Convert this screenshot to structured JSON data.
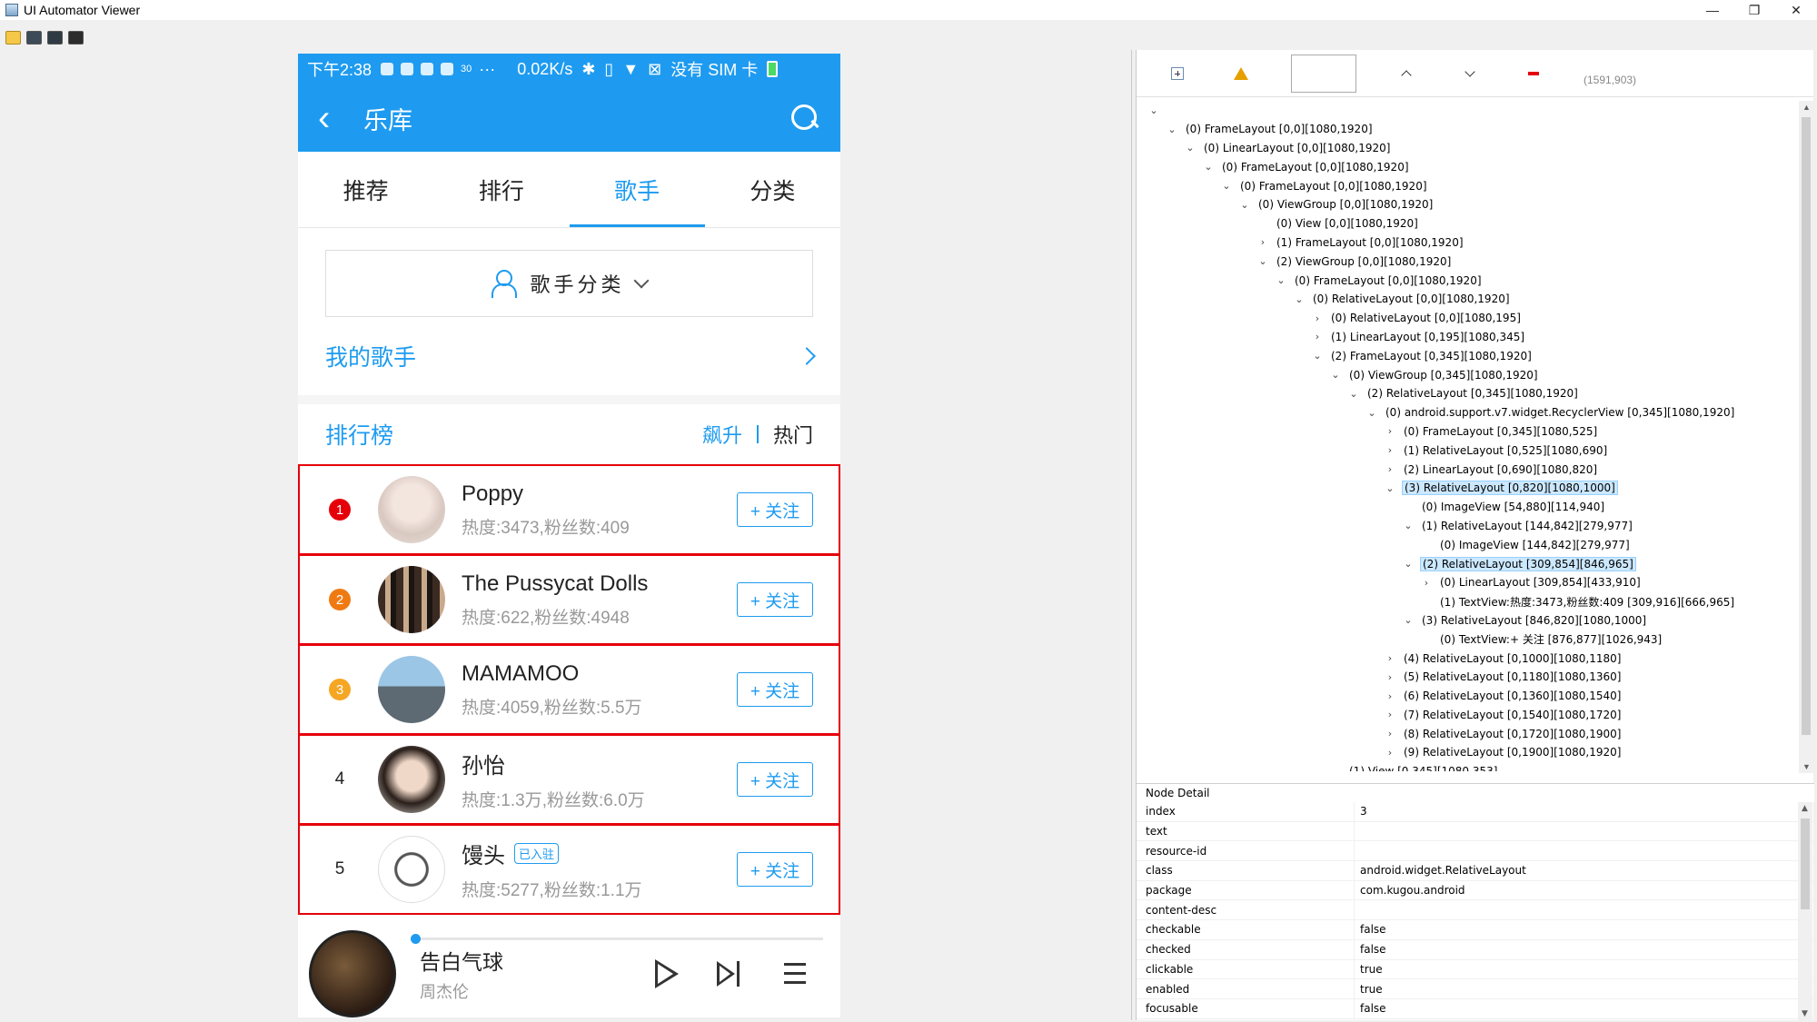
{
  "window": {
    "title": "UI Automator Viewer",
    "minimize": "—",
    "restore": "❐",
    "close": "✕"
  },
  "toolbar": {
    "items": [
      "open-icon",
      "screenshot-icon",
      "screenshot-compressed-icon",
      "save-icon"
    ]
  },
  "phone": {
    "status": {
      "time": "下午2:38",
      "speed": "0.02K/s",
      "carrier": "没有 SIM 卡",
      "dots": "···",
      "signal_num": "30"
    },
    "header": {
      "back": "‹",
      "title": "乐库"
    },
    "tabs": [
      {
        "label": "推荐",
        "active": false
      },
      {
        "label": "排行",
        "active": false
      },
      {
        "label": "歌手",
        "active": true
      },
      {
        "label": "分类",
        "active": false
      }
    ],
    "category_button": "歌手分类",
    "my_singers": "我的歌手",
    "ranking": {
      "title": "排行榜",
      "tab_soar": "飙升",
      "tab_hot": "热门"
    },
    "singers": [
      {
        "rank": "1",
        "name": "Poppy",
        "stats": "热度:3473,粉丝数:409",
        "follow": "+ 关注",
        "badge_color": "#e5000a",
        "avatar": "avatar-poppy",
        "entered": ""
      },
      {
        "rank": "2",
        "name": "The Pussycat Dolls",
        "stats": "热度:622,粉丝数:4948",
        "follow": "+ 关注",
        "badge_color": "#f07a12",
        "avatar": "avatar-pcd",
        "entered": ""
      },
      {
        "rank": "3",
        "name": "MAMAMOO",
        "stats": "热度:4059,粉丝数:5.5万",
        "follow": "+ 关注",
        "badge_color": "#f5a623",
        "avatar": "avatar-mamamoo",
        "entered": ""
      },
      {
        "rank": "4",
        "name": "孙怡",
        "stats": "热度:1.3万,粉丝数:6.0万",
        "follow": "+ 关注",
        "badge_color": "",
        "avatar": "avatar-sunyi",
        "entered": ""
      },
      {
        "rank": "5",
        "name": "馒头",
        "stats": "热度:5277,粉丝数:1.1万",
        "follow": "+ 关注",
        "badge_color": "",
        "avatar": "avatar-mantou",
        "entered": "已入驻"
      }
    ],
    "player": {
      "title": "告白气球",
      "artist": "周杰伦"
    }
  },
  "inspector": {
    "coord": "(1591,903)",
    "tree": [
      {
        "depth": 0,
        "twisty": "v",
        "label": ""
      },
      {
        "depth": 1,
        "twisty": "v",
        "label": "(0) FrameLayout [0,0][1080,1920]"
      },
      {
        "depth": 2,
        "twisty": "v",
        "label": "(0) LinearLayout [0,0][1080,1920]"
      },
      {
        "depth": 3,
        "twisty": "v",
        "label": "(0) FrameLayout [0,0][1080,1920]"
      },
      {
        "depth": 4,
        "twisty": "v",
        "label": "(0) FrameLayout [0,0][1080,1920]"
      },
      {
        "depth": 5,
        "twisty": "v",
        "label": "(0) ViewGroup [0,0][1080,1920]"
      },
      {
        "depth": 6,
        "twisty": "",
        "label": "(0) View [0,0][1080,1920]"
      },
      {
        "depth": 6,
        "twisty": ">",
        "label": "(1) FrameLayout [0,0][1080,1920]"
      },
      {
        "depth": 6,
        "twisty": "v",
        "label": "(2) ViewGroup [0,0][1080,1920]"
      },
      {
        "depth": 7,
        "twisty": "v",
        "label": "(0) FrameLayout [0,0][1080,1920]"
      },
      {
        "depth": 8,
        "twisty": "v",
        "label": "(0) RelativeLayout [0,0][1080,1920]"
      },
      {
        "depth": 9,
        "twisty": ">",
        "label": "(0) RelativeLayout [0,0][1080,195]"
      },
      {
        "depth": 9,
        "twisty": ">",
        "label": "(1) LinearLayout [0,195][1080,345]"
      },
      {
        "depth": 9,
        "twisty": "v",
        "label": "(2) FrameLayout [0,345][1080,1920]"
      },
      {
        "depth": 10,
        "twisty": "v",
        "label": "(0) ViewGroup [0,345][1080,1920]"
      },
      {
        "depth": 11,
        "twisty": "v",
        "label": "(2) RelativeLayout [0,345][1080,1920]"
      },
      {
        "depth": 12,
        "twisty": "v",
        "label": "(0) android.support.v7.widget.RecyclerView [0,345][1080,1920]"
      },
      {
        "depth": 13,
        "twisty": ">",
        "label": "(0) FrameLayout [0,345][1080,525]"
      },
      {
        "depth": 13,
        "twisty": ">",
        "label": "(1) RelativeLayout [0,525][1080,690]"
      },
      {
        "depth": 13,
        "twisty": ">",
        "label": "(2) LinearLayout [0,690][1080,820]"
      },
      {
        "depth": 13,
        "twisty": "v",
        "label": "(3) RelativeLayout [0,820][1080,1000]",
        "selected": true
      },
      {
        "depth": 14,
        "twisty": "",
        "label": "(0) ImageView [54,880][114,940]"
      },
      {
        "depth": 14,
        "twisty": "v",
        "label": "(1) RelativeLayout [144,842][279,977]"
      },
      {
        "depth": 15,
        "twisty": "",
        "label": "(0) ImageView [144,842][279,977]"
      },
      {
        "depth": 14,
        "twisty": "v",
        "label": "(2) RelativeLayout [309,854][846,965]",
        "selected": true
      },
      {
        "depth": 15,
        "twisty": ">",
        "label": "(0) LinearLayout [309,854][433,910]"
      },
      {
        "depth": 15,
        "twisty": "",
        "label": "(1) TextView:热度:3473,粉丝数:409 [309,916][666,965]"
      },
      {
        "depth": 14,
        "twisty": "v",
        "label": "(3) RelativeLayout [846,820][1080,1000]"
      },
      {
        "depth": 15,
        "twisty": "",
        "label": "(0) TextView:+ 关注 [876,877][1026,943]"
      },
      {
        "depth": 13,
        "twisty": ">",
        "label": "(4) RelativeLayout [0,1000][1080,1180]"
      },
      {
        "depth": 13,
        "twisty": ">",
        "label": "(5) RelativeLayout [0,1180][1080,1360]"
      },
      {
        "depth": 13,
        "twisty": ">",
        "label": "(6) RelativeLayout [0,1360][1080,1540]"
      },
      {
        "depth": 13,
        "twisty": ">",
        "label": "(7) RelativeLayout [0,1540][1080,1720]"
      },
      {
        "depth": 13,
        "twisty": ">",
        "label": "(8) RelativeLayout [0,1720][1080,1900]"
      },
      {
        "depth": 13,
        "twisty": ">",
        "label": "(9) RelativeLayout [0,1900][1080,1920]"
      },
      {
        "depth": 10,
        "twisty": "",
        "label": "(1) View [0,345][1080,353]"
      }
    ],
    "node_detail": {
      "title": "Node Detail",
      "rows": [
        {
          "k": "index",
          "v": "3"
        },
        {
          "k": "text",
          "v": ""
        },
        {
          "k": "resource-id",
          "v": ""
        },
        {
          "k": "class",
          "v": "android.widget.RelativeLayout"
        },
        {
          "k": "package",
          "v": "com.kugou.android"
        },
        {
          "k": "content-desc",
          "v": ""
        },
        {
          "k": "checkable",
          "v": "false"
        },
        {
          "k": "checked",
          "v": "false"
        },
        {
          "k": "clickable",
          "v": "true"
        },
        {
          "k": "enabled",
          "v": "true"
        },
        {
          "k": "focusable",
          "v": "false"
        }
      ]
    }
  }
}
